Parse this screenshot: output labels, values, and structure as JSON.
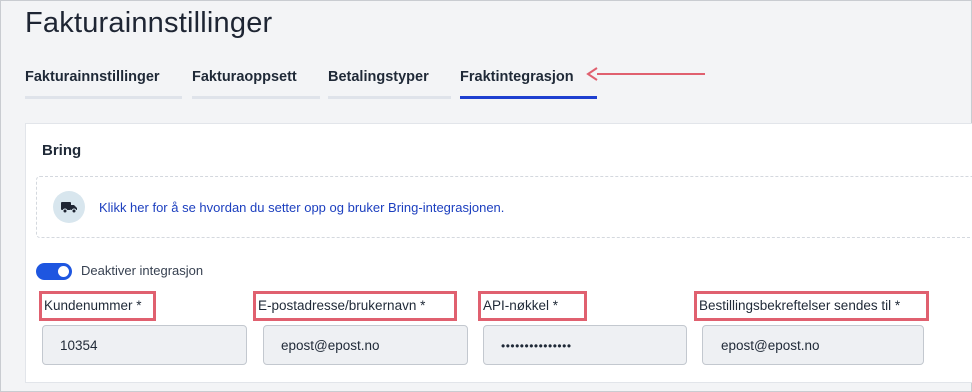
{
  "page": {
    "title": "Fakturainnstillinger"
  },
  "tabs": [
    {
      "label": "Fakturainnstillinger",
      "active": false
    },
    {
      "label": "Fakturaoppsett",
      "active": false
    },
    {
      "label": "Betalingstyper",
      "active": false
    },
    {
      "label": "Fraktintegrasjon",
      "active": true
    }
  ],
  "colors": {
    "accent": "#1e3fd0",
    "annotation": "#e0606f",
    "link": "#1c3fbf",
    "toggle_on": "#1e56e0"
  },
  "card": {
    "title": "Bring",
    "info": {
      "icon": "truck-icon",
      "link_text": "Klikk her for å se hvordan du setter opp og bruker Bring-integrasjonen."
    },
    "toggle": {
      "label": "Deaktiver integrasjon",
      "on": true
    },
    "fields": [
      {
        "label": "Kundenummer *",
        "value": "10354"
      },
      {
        "label": "E-postadresse/brukernavn *",
        "value": "epost@epost.no"
      },
      {
        "label": "API-nøkkel *",
        "value": "•••••••••••••••"
      },
      {
        "label": "Bestillingsbekreftelser sendes til *",
        "value": "epost@epost.no"
      }
    ]
  }
}
